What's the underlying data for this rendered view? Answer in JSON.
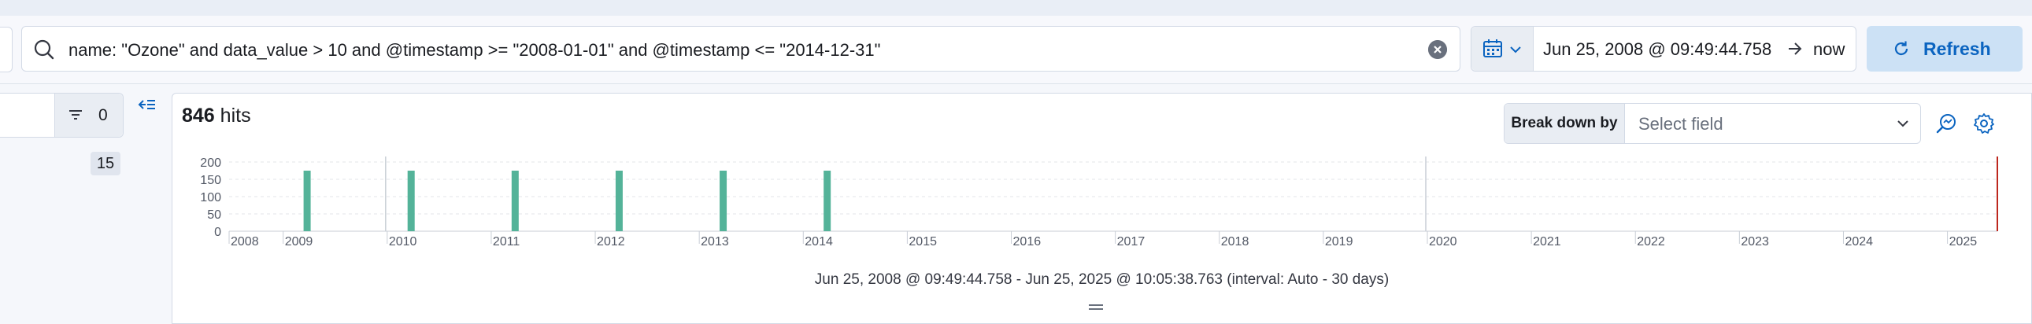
{
  "query": {
    "text": "name: \"Ozone\" and data_value > 10 and @timestamp >= \"2008-01-01\" and @timestamp <= \"2014-12-31\""
  },
  "time": {
    "start": "Jun 25, 2008 @ 09:49:44.758",
    "end": "now"
  },
  "refresh": {
    "label": "Refresh"
  },
  "sidebar": {
    "filter_count": "0",
    "field_count": "15"
  },
  "hits": {
    "count": "846",
    "label": "hits"
  },
  "breakdown": {
    "label": "Break down by",
    "placeholder": "Select field"
  },
  "histogram": {
    "range_text": "Jun 25, 2008 @ 09:49:44.758 - Jun 25, 2025 @ 10:05:38.763 (interval: Auto - 30 days)"
  },
  "chart_data": {
    "type": "bar",
    "x_tick_labels": [
      "2008",
      "2009",
      "2010",
      "2011",
      "2012",
      "2013",
      "2014",
      "2015",
      "2016",
      "2017",
      "2018",
      "2019",
      "2020",
      "2021",
      "2022",
      "2023",
      "2024",
      "2025"
    ],
    "y_tick_labels": [
      "0",
      "50",
      "100",
      "150",
      "200"
    ],
    "ylim": [
      0,
      200
    ],
    "xlim": [
      2008.48,
      2025.48
    ],
    "series": [
      {
        "x": [
          2009.23,
          2010.23,
          2011.23,
          2012.23,
          2013.23,
          2014.23
        ],
        "values": [
          175,
          175,
          175,
          175,
          175,
          175
        ]
      }
    ],
    "bar_color": "#54b399",
    "grid": true
  }
}
